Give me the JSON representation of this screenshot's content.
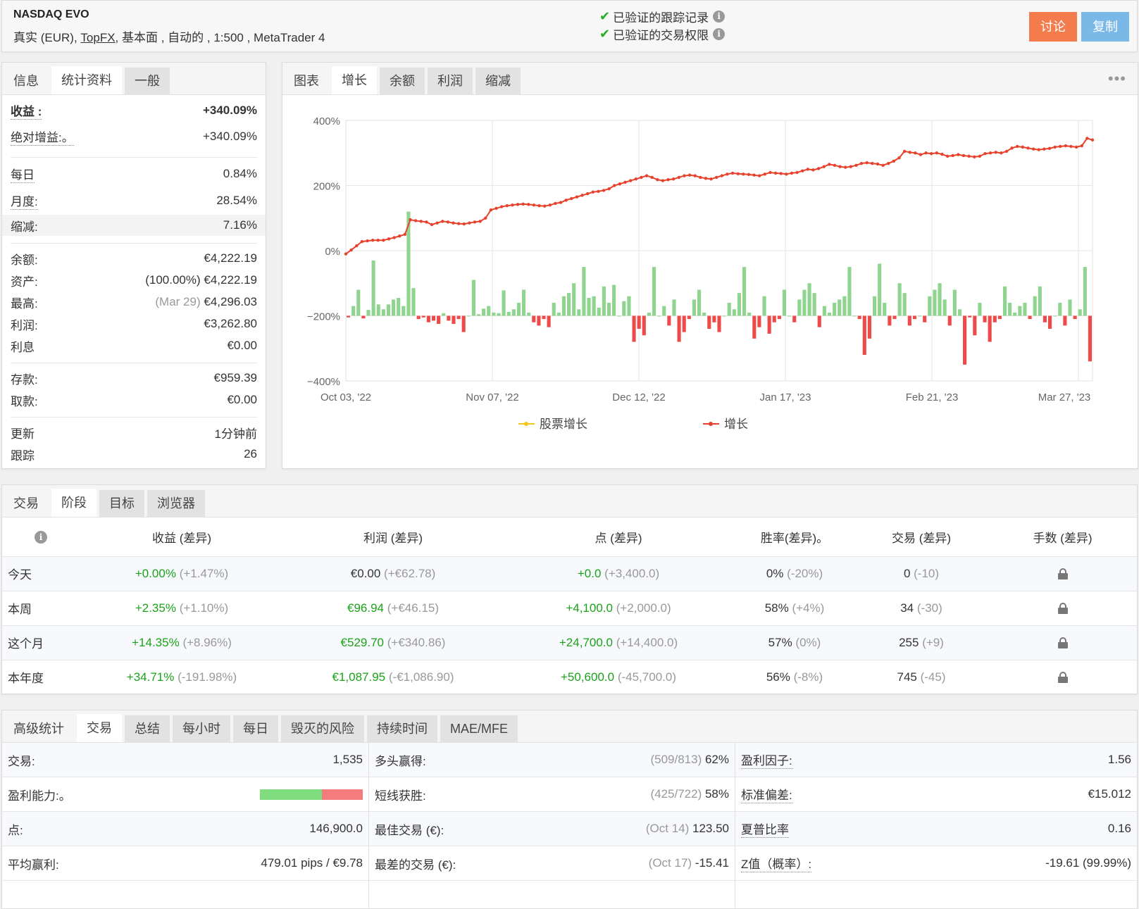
{
  "header": {
    "account_name": "NASDAQ EVO",
    "account_type": "真实 (EUR),",
    "broker": "TopFX",
    "account_details": ", 基本面 , 自动的 , 1:500 , MetaTrader 4",
    "verified_track": "已验证的跟踪记录",
    "verified_trading": "已验证的交易权限",
    "discuss_label": "讨论",
    "copy_label": "复制"
  },
  "info_tabs": [
    "信息",
    "统计资料",
    "一般"
  ],
  "info": {
    "gain_label": "收益 :",
    "gain_value": "+340.09%",
    "abs_gain_label": "绝对增益:。",
    "abs_gain_value": "+340.09%",
    "daily_label": "每日",
    "daily_value": "0.84%",
    "monthly_label": "月度:",
    "monthly_value": "28.54%",
    "drawdown_label": "缩减:",
    "drawdown_value": "7.16%",
    "balance_label": "余额:",
    "balance_value": "€4,222.19",
    "equity_label": "资产:",
    "equity_value": "(100.00%) €4,222.19",
    "highest_label": "最高:",
    "highest_date": "(Mar 29)",
    "highest_value": "€4,296.03",
    "profit_label": "利润:",
    "profit_value": "€3,262.80",
    "interest_label": "利息",
    "interest_value": "€0.00",
    "deposits_label": "存款:",
    "deposits_value": "€959.39",
    "withdrawals_label": "取款:",
    "withdrawals_value": "€0.00",
    "updated_label": "更新",
    "updated_value": "1分钟前",
    "tracking_label": "跟踪",
    "tracking_value": "26"
  },
  "chart_tabs": [
    "图表",
    "增长",
    "余额",
    "利润",
    "缩减"
  ],
  "chart_more": "•••",
  "chart_data": {
    "type": "line",
    "y_ticks": [
      "400%",
      "200%",
      "0%",
      "−200%",
      "−400%"
    ],
    "ylim": [
      -400,
      400
    ],
    "x_ticks": [
      "Oct 03, '22",
      "Nov 07, '22",
      "Dec 12, '22",
      "Jan 17, '23",
      "Feb 21, '23",
      "Mar 27, '23"
    ],
    "legend": [
      "股票增长",
      "增长"
    ],
    "series_colors": {
      "equity": "#f5c518",
      "growth": "#e8412c",
      "bar_pos": "#8fd48f",
      "bar_neg": "#ef4a4a"
    },
    "growth": [
      -10,
      2,
      15,
      28,
      30,
      32,
      32,
      32,
      36,
      40,
      45,
      50,
      95,
      92,
      90,
      88,
      80,
      85,
      90,
      88,
      85,
      83,
      82,
      85,
      88,
      90,
      100,
      125,
      130,
      135,
      138,
      140,
      142,
      143,
      142,
      140,
      138,
      137,
      140,
      145,
      148,
      155,
      160,
      165,
      170,
      175,
      180,
      182,
      185,
      190,
      200,
      205,
      210,
      215,
      220,
      225,
      230,
      225,
      218,
      215,
      218,
      220,
      225,
      230,
      232,
      230,
      225,
      222,
      220,
      225,
      230,
      235,
      238,
      236,
      235,
      234,
      232,
      230,
      235,
      240,
      238,
      237,
      235,
      238,
      240,
      245,
      250,
      248,
      252,
      258,
      265,
      262,
      258,
      256,
      258,
      262,
      268,
      270,
      268,
      266,
      262,
      268,
      275,
      285,
      305,
      302,
      300,
      295,
      300,
      298,
      300,
      296,
      290,
      292,
      295,
      292,
      290,
      288,
      290,
      298,
      300,
      302,
      300,
      305,
      315,
      320,
      318,
      315,
      312,
      310,
      312,
      314,
      318,
      320,
      322,
      320,
      318,
      322,
      345,
      340
    ],
    "bars": [
      -5,
      30,
      80,
      -8,
      18,
      170,
      35,
      20,
      35,
      50,
      55,
      30,
      320,
      85,
      -10,
      -5,
      -20,
      -15,
      -25,
      8,
      -15,
      -25,
      -10,
      -50,
      0,
      110,
      5,
      22,
      30,
      10,
      8,
      78,
      12,
      20,
      40,
      80,
      10,
      -20,
      -30,
      -10,
      -35,
      40,
      10,
      60,
      70,
      100,
      20,
      150,
      55,
      60,
      25,
      90,
      40,
      95,
      0,
      45,
      60,
      -80,
      -40,
      -60,
      10,
      150,
      0,
      30,
      -30,
      50,
      -80,
      -50,
      -10,
      50,
      80,
      10,
      -40,
      -20,
      -50,
      0,
      40,
      20,
      70,
      150,
      10,
      -70,
      -35,
      60,
      -55,
      -20,
      -10,
      80,
      0,
      -20,
      50,
      80,
      100,
      70,
      -35,
      30,
      10,
      40,
      50,
      60,
      150,
      0,
      -10,
      -120,
      -70,
      60,
      160,
      40,
      -30,
      -10,
      100,
      70,
      -30,
      -10,
      0,
      -20,
      60,
      80,
      100,
      50,
      -30,
      80,
      20,
      -150,
      -5,
      -60,
      40,
      -20,
      -80,
      -20,
      -10,
      90,
      40,
      10,
      30,
      40,
      -10,
      60,
      90,
      -20,
      -40,
      0,
      40,
      -30,
      50,
      -10,
      20,
      150,
      -140
    ]
  },
  "period_tabs": [
    "交易",
    "阶段",
    "目标",
    "浏览器"
  ],
  "period_headers": [
    "收益 (差异)",
    "利润 (差异)",
    "点 (差异)",
    "胜率(差异)。",
    "交易 (差异)",
    "手数 (差异)"
  ],
  "periods": [
    {
      "label": "今天",
      "gain": "+0.00%",
      "gain_diff": "(+1.47%)",
      "profit": "€0.00",
      "profit_diff": "(+€62.78)",
      "pips": "+0.0",
      "pips_diff": "(+3,400.0)",
      "win": "0%",
      "win_diff": "(-20%)",
      "trades": "0",
      "trades_diff": "(-10)"
    },
    {
      "label": "本周",
      "gain": "+2.35%",
      "gain_diff": "(+1.10%)",
      "profit": "€96.94",
      "profit_diff": "(+€46.15)",
      "pips": "+4,100.0",
      "pips_diff": "(+2,000.0)",
      "win": "58%",
      "win_diff": "(+4%)",
      "trades": "34",
      "trades_diff": "(-30)"
    },
    {
      "label": "这个月",
      "gain": "+14.35%",
      "gain_diff": "(+8.96%)",
      "profit": "€529.70",
      "profit_diff": "(+€340.86)",
      "pips": "+24,700.0",
      "pips_diff": "(+14,400.0)",
      "win": "57%",
      "win_diff": "(0%)",
      "trades": "255",
      "trades_diff": "(+9)"
    },
    {
      "label": "本年度",
      "gain": "+34.71%",
      "gain_diff": "(-191.98%)",
      "profit": "€1,087.95",
      "profit_diff": "(-€1,086.90)",
      "pips": "+50,600.0",
      "pips_diff": "(-45,700.0)",
      "win": "56%",
      "win_diff": "(-8%)",
      "trades": "745",
      "trades_diff": "(-45)"
    }
  ],
  "adv_tabs": [
    "高级统计",
    "交易",
    "总结",
    "每小时",
    "每日",
    "毁灭的风险",
    "持续时间",
    "MAE/MFE"
  ],
  "adv": {
    "trades_label": "交易:",
    "trades_value": "1,535",
    "profitability_label": "盈利能力:。",
    "profitability_win_fraction": 0.6,
    "pips_label": "点:",
    "pips_value": "146,900.0",
    "avg_win_label": "平均赢利:",
    "avg_win_value": "479.01 pips / €9.78",
    "longs_label": "多头赢得:",
    "longs_ratio": "(509/813)",
    "longs_value": "62%",
    "shorts_label": "短线获胜:",
    "shorts_ratio": "(425/722)",
    "shorts_value": "58%",
    "best_label": "最佳交易 (€):",
    "best_date": "(Oct 14)",
    "best_value": "123.50",
    "worst_label": "最差的交易 (€):",
    "worst_date": "(Oct 17)",
    "worst_value": "-15.41",
    "pf_label": "盈利因子:",
    "pf_value": "1.56",
    "sd_label": "标准偏差:",
    "sd_value": "€15.012",
    "sharpe_label": "夏普比率",
    "sharpe_value": "0.16",
    "z_label": "Z值（概率）:",
    "z_value": "-19.61 (99.99%)"
  }
}
